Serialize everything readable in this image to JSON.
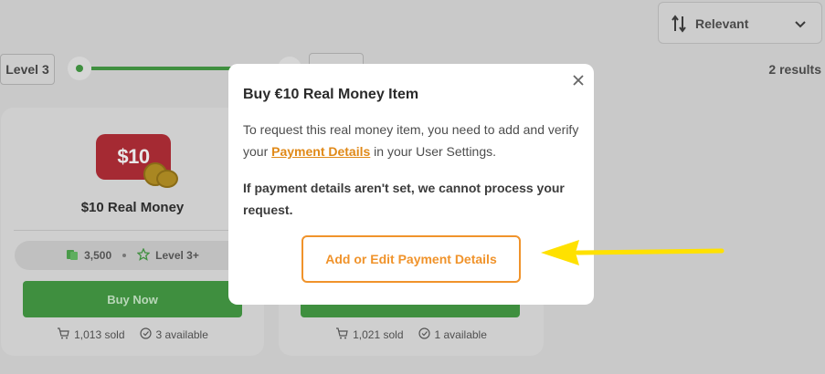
{
  "sort": {
    "label": "Relevant",
    "icon": "sort-arrows-icon"
  },
  "results_count": "2 results",
  "level_filter": {
    "label": "Level 3"
  },
  "cards": [
    {
      "badge": "$10",
      "title": "$10 Real Money",
      "price": "3,500",
      "level": "Level 3+",
      "button": "Buy Now",
      "sold": "1,013 sold",
      "available": "3 available"
    },
    {
      "button": "",
      "sold": "1,021 sold",
      "available": "1 available"
    }
  ],
  "modal": {
    "title": "Buy €10 Real Money Item",
    "body_pre": "To request this real money item, you need to add and verify your ",
    "body_link": "Payment Details",
    "body_post": " in your User Settings.",
    "warning": "If payment details aren't set, we cannot process your request.",
    "action_label": "Add or Edit Payment Details",
    "accent_color": "#f0932b"
  },
  "colors": {
    "buy_button": "#3f8f3f",
    "arrow": "#ffe100",
    "badge": "#a52a33"
  }
}
